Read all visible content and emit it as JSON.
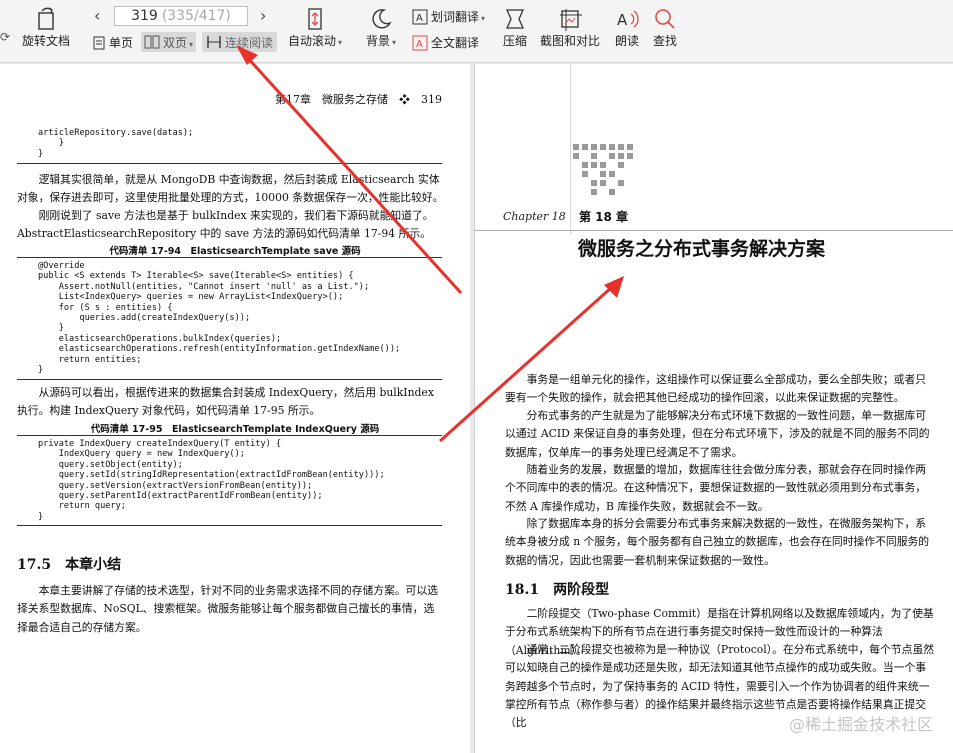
{
  "toolbar": {
    "rotate_label": "旋转文档",
    "page_current": "319",
    "page_total": "(335/417)",
    "single_label": "单页",
    "double_label": "双页",
    "continuous_label": "连续阅读",
    "autoscroll_label": "自动滚动",
    "background_label": "背景",
    "word_translate_label": "划词翻译",
    "full_translate_label": "全文翻译",
    "compress_label": "压缩",
    "screenshot_label": "截图和对比",
    "read_aloud_label": "朗读",
    "search_label": "查找"
  },
  "left_page": {
    "header": "第17章　微服务之存储　❖　319",
    "code1": "articleRepository.save(datas);\n    }\n}",
    "para1": "逻辑其实很简单，就是从 MongoDB 中查询数据，然后封装成 Elasticsearch 实体对象，保存进去即可，这里使用批量处理的方式，10000 条数据保存一次，性能比较好。",
    "para2": "刚刚说到了 save 方法也是基于 bulkIndex 来实现的，我们看下源码就能知道了。AbstractElasticsearchRepository 中的 save 方法的源码如代码清单 17-94 所示。",
    "caption1": "代码清单 17-94　ElasticsearchTemplate save 源码",
    "code2": "@Override\npublic <S extends T> Iterable<S> save(Iterable<S> entities) {\n    Assert.notNull(entities, \"Cannot insert 'null' as a List.\");\n    List<IndexQuery> queries = new ArrayList<IndexQuery>();\n    for (S s : entities) {\n        queries.add(createIndexQuery(s));\n    }\n    elasticsearchOperations.bulkIndex(queries);\n    elasticsearchOperations.refresh(entityInformation.getIndexName());\n    return entities;\n}",
    "para3": "从源码可以看出，根据传进来的数据集合封装成 IndexQuery，然后用 bulkIndex 执行。构建 IndexQuery 对象代码，如代码清单 17-95 所示。",
    "caption2": "代码清单 17-95　ElasticsearchTemplate IndexQuery 源码",
    "code3": "private IndexQuery createIndexQuery(T entity) {\n    IndexQuery query = new IndexQuery();\n    query.setObject(entity);\n    query.setId(stringIdRepresentation(extractIdFromBean(entity)));\n    query.setVersion(extractVersionFromBean(entity));\n    query.setParentId(extractParentIdFromBean(entity));\n    return query;\n}",
    "section": "17.5　本章小结",
    "para4": "本章主要讲解了存储的技术选型，针对不同的业务需求选择不同的存储方案。可以选择关系型数据库、NoSQL、搜索框架。微服务能够让每个服务都做自己擅长的事情，选择最合适自己的存储方案。"
  },
  "right_page": {
    "chapter_script": "Chapter 18",
    "chapter_num": "第 18 章",
    "chapter_title": "微服务之分布式事务解决方案",
    "para1": "事务是一组单元化的操作，这组操作可以保证要么全部成功，要么全部失败；或者只要有一个失败的操作，就会把其他已经成功的操作回滚，以此来保证数据的完整性。",
    "para2": "分布式事务的产生就是为了能够解决分布式环境下数据的一致性问题，单一数据库可以通过 ACID 来保证自身的事务处理，但在分布式环境下，涉及的就是不同的服务不同的数据库，仅单库一的事务处理已经满足不了需求。",
    "para3": "随着业务的发展，数据量的增加，数据库往往会做分库分表，那就会存在同时操作两个不同库中的表的情况。在这种情况下，要想保证数据的一致性就必须用到分布式事务，不然 A 库操作成功，B 库操作失败，数据就会不一致。",
    "para4": "除了数据库本身的拆分会需要分布式事务来解决数据的一致性，在微服务架构下，系统本身被分成 n 个服务，每个服务都有自己独立的数据库，也会存在同时操作不同服务的数据的情况，因此也需要一套机制来保证数据的一致性。",
    "section": "18.1　两阶段型",
    "para5": "二阶段提交（Two-phase Commit）是指在计算机网络以及数据库领域内，为了使基于分布式系统架构下的所有节点在进行事务提交时保持一致性而设计的一种算法（Algorithm）。",
    "para6": "通常，二阶段提交也被称为是一种协议（Protocol）。在分布式系统中，每个节点虽然可以知晓自己的操作是成功还是失败，却无法知道其他节点操作的成功或失败。当一个事务跨越多个节点时，为了保持事务的 ACID 特性，需要引入一个作为协调者的组件来统一掌控所有节点（称作参与者）的操作结果并最终指示这些节点是否要将操作结果真正提交（比"
  },
  "watermark": "@稀土掘金技术社区",
  "colors": {
    "arrow": "#e8312a",
    "accent": "#e04a4a"
  }
}
